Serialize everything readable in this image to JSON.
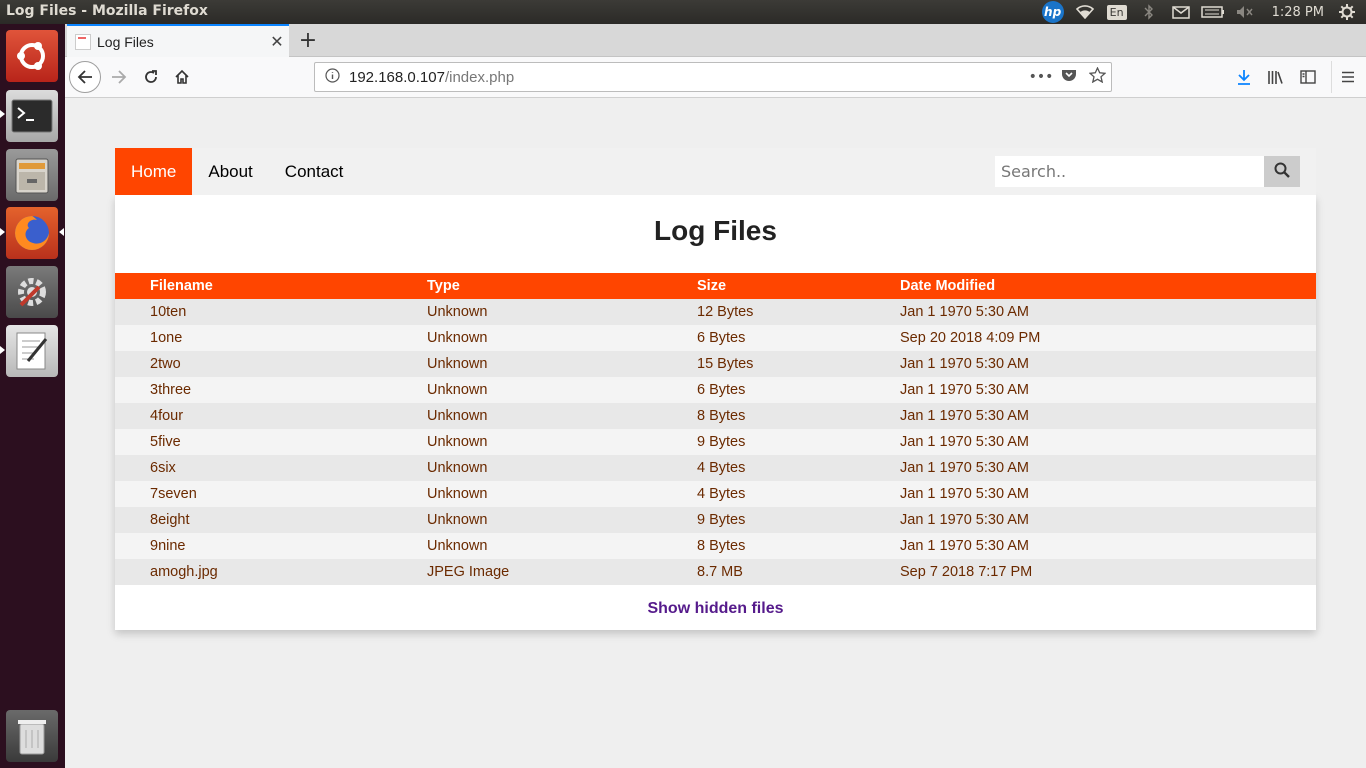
{
  "os": {
    "window_title": "Log Files - Mozilla Firefox",
    "clock": "1:28 PM",
    "keyboard_layout": "En",
    "tray_icons": [
      "hp-icon",
      "wifi-icon",
      "keyboard-layout-icon",
      "bluetooth-icon",
      "mail-icon",
      "battery-icon",
      "volume-icon",
      "settings-gear-icon"
    ],
    "launcher_apps": [
      "ubuntu-dash-icon",
      "terminal-icon",
      "files-icon",
      "firefox-icon",
      "system-settings-icon",
      "text-editor-icon",
      "trash-icon"
    ]
  },
  "browser": {
    "tab_title": "Log Files",
    "url_host": "192.168.0.107",
    "url_path": "/index.php",
    "accent": "#0a84ff"
  },
  "site": {
    "nav": [
      "Home",
      "About",
      "Contact"
    ],
    "search_placeholder": "Search..",
    "heading": "Log Files",
    "accent": "#ff4500",
    "columns": [
      "Filename",
      "Type",
      "Size",
      "Date Modified"
    ],
    "rows": [
      [
        "10ten",
        "Unknown",
        "12 Bytes",
        "Jan 1 1970 5:30 AM"
      ],
      [
        "1one",
        "Unknown",
        "6 Bytes",
        "Sep 20 2018 4:09 PM"
      ],
      [
        "2two",
        "Unknown",
        "15 Bytes",
        "Jan 1 1970 5:30 AM"
      ],
      [
        "3three",
        "Unknown",
        "6 Bytes",
        "Jan 1 1970 5:30 AM"
      ],
      [
        "4four",
        "Unknown",
        "8 Bytes",
        "Jan 1 1970 5:30 AM"
      ],
      [
        "5five",
        "Unknown",
        "9 Bytes",
        "Jan 1 1970 5:30 AM"
      ],
      [
        "6six",
        "Unknown",
        "4 Bytes",
        "Jan 1 1970 5:30 AM"
      ],
      [
        "7seven",
        "Unknown",
        "4 Bytes",
        "Jan 1 1970 5:30 AM"
      ],
      [
        "8eight",
        "Unknown",
        "9 Bytes",
        "Jan 1 1970 5:30 AM"
      ],
      [
        "9nine",
        "Unknown",
        "8 Bytes",
        "Jan 1 1970 5:30 AM"
      ],
      [
        "amogh.jpg",
        "JPEG Image",
        "8.7 MB",
        "Sep 7 2018 7:17 PM"
      ]
    ],
    "show_hidden_label": "Show hidden files"
  }
}
